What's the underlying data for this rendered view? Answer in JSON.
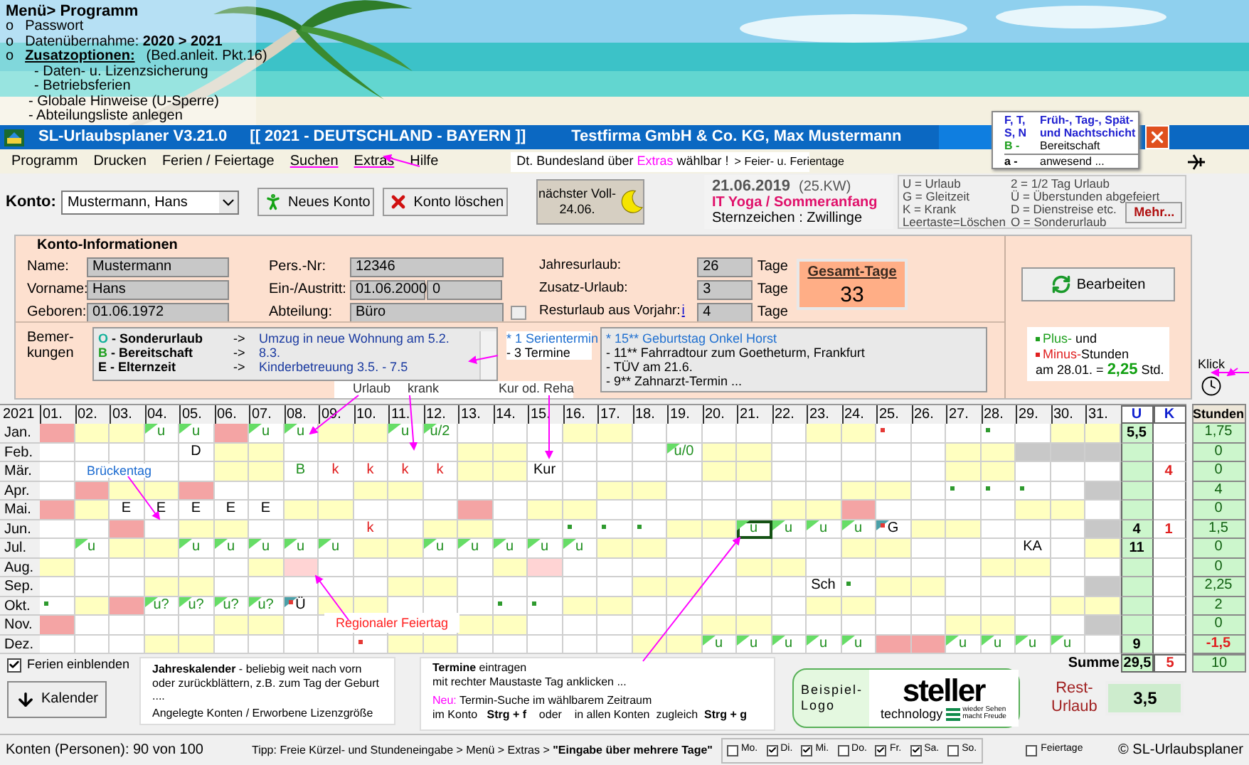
{
  "banner": {
    "menu_title": "Menü> Programm",
    "items": [
      {
        "bullet": "o",
        "text": "Passwort",
        "kind": "plain"
      },
      {
        "bullet": "o",
        "text": "Datenübernahme: **2020  >  2021**",
        "kind": "plain"
      },
      {
        "bullet": "o",
        "text": "**Zusatzoptionen:**",
        "note": "(Bed.anleit. Pkt.16)",
        "kind": "heading"
      }
    ],
    "subitems": [
      "- Daten-  u. Lizenzsicherung",
      "- Betriebsferien",
      "- Globale Hinweise (U-Sperre)",
      "- Abteilungsliste anlegen"
    ]
  },
  "title_bar": {
    "app": "SL-Urlaubsplaner  V3.21.0",
    "context": "[[ 2021 - DEUTSCHLAND - BAYERN ]]",
    "company": "Testfirma GmbH & Co. KG,  Max Mustermann"
  },
  "note_popup": [
    {
      "code": "F, T,",
      "desc": "Früh-, Tag-, Spät-",
      "kind": "shift"
    },
    {
      "code": "S, N",
      "desc": "und Nachtschicht",
      "kind": "shift"
    },
    {
      "code": "B -",
      "desc": "Bereitschaft",
      "kind": "standby"
    },
    {
      "code": "a -",
      "desc": "anwesend ...",
      "kind": "present"
    }
  ],
  "menu": [
    {
      "label": "Programm",
      "highlighted": false
    },
    {
      "label": "Drucken",
      "highlighted": false
    },
    {
      "label": "Ferien / Feiertage",
      "highlighted": false
    },
    {
      "label": "Suchen",
      "highlighted": true
    },
    {
      "label": "Extras",
      "highlighted": true
    },
    {
      "label": "Hilfe",
      "highlighted": false
    }
  ],
  "hint": {
    "before": "Dt. Bundesland  über",
    "highlight": "Extras",
    "after": "wählbar !",
    "link": "> Feier- u. Ferientage"
  },
  "toolbar": {
    "konto_label": "Konto:",
    "konto_value": "Mustermann, Hans",
    "buttons": [
      {
        "label": "Neues Konto",
        "kind": "new"
      },
      {
        "label": "Konto löschen",
        "kind": "delete"
      }
    ],
    "moon": [
      "nächster Voll-",
      "24.06."
    ]
  },
  "date_panel": {
    "date": "21.06.2019",
    "week": "(25.KW)",
    "event": "IT Yoga /  Sommeranfang",
    "zodiac": "Sternzeichen : Zwillinge"
  },
  "legend": {
    "left": [
      "U = Urlaub",
      "G = Gleitzeit",
      "K = Krank",
      "Leertaste=Löschen"
    ],
    "right": [
      "2 = 1/2 Tag Urlaub",
      "Ü = Überstunden abgefeiert",
      "D = Dienstreise etc.",
      "O = Sonderurlaub"
    ],
    "more": "Mehr..."
  },
  "account": {
    "title": "Konto-Informationen",
    "personal": [
      {
        "label": "Name:",
        "values": [
          "Mustermann"
        ]
      },
      {
        "label": "Vorname:",
        "values": [
          "Hans"
        ]
      },
      {
        "label": "Geboren:",
        "values": [
          "01.06.1972"
        ]
      }
    ],
    "work": [
      {
        "label": "Pers.-Nr:",
        "values": [
          "12346"
        ]
      },
      {
        "label": "Ein-/Austritt:",
        "values": [
          "01.06.2000",
          "0"
        ]
      },
      {
        "label": "Abteilung:",
        "values": [
          "Büro"
        ]
      }
    ],
    "vacation": [
      {
        "label": "Jahresurlaub:",
        "value": "26",
        "unit": "Tage"
      },
      {
        "label": "Zusatz-Urlaub:",
        "value": "3",
        "unit": "Tage"
      },
      {
        "label": "Resturlaub aus Vorjahr:",
        "info": "i",
        "value": "4",
        "unit": "Tage"
      }
    ],
    "total_label": "Gesamt-Tage",
    "total": "33",
    "edit": "Bearbeiten",
    "remarks_label": "Bemer-\nkungen",
    "remarks": [
      {
        "code": "O",
        "label": "- Sonderurlaub",
        "arrow": "->",
        "text": "Umzug in neue Wohnung am  5.2.",
        "kind": "special"
      },
      {
        "code": "B",
        "label": "- Bereitschaft",
        "arrow": "->",
        "text": "8.3.",
        "kind": "standby"
      },
      {
        "code": "E",
        "label": "- Elternzeit",
        "arrow": "->",
        "text": "Kinderbetreuung  3.5. - 7.5",
        "kind": "plain"
      }
    ],
    "series": [
      {
        "text": "* 1 Serientermin",
        "kind": "series"
      },
      {
        "text": "- 3 Termine",
        "kind": "plain"
      }
    ],
    "appointments": [
      {
        "text": "*   15**  Geburtstag Onkel Horst",
        "kind": "birthday"
      },
      {
        "text": "-   11**  Fahrradtour zum Goetheturm,  Frankfurt",
        "kind": "plain"
      },
      {
        "text": "-   TÜV am 21.6.",
        "kind": "plain"
      },
      {
        "text": "-   9**  Zahnarzt-Termin  ...",
        "kind": "plain"
      }
    ],
    "hours_note": {
      "plus": "Plus-",
      "plus_rest": "und",
      "minus": "Minus-",
      "minus_rest": "Stunden",
      "date": "am 28.01.  =",
      "value": "2,25",
      "unit": "Std."
    }
  },
  "annotations": {
    "vacation": "Urlaub",
    "sick": "krank",
    "cure": "Kur od. Reha",
    "bridge": "Brückentag",
    "regional": "Regionaler Feiertag",
    "click": "Klick"
  },
  "calendar": {
    "year": "2021",
    "days": [
      "01.",
      "02.",
      "03.",
      "04.",
      "05.",
      "06.",
      "07.",
      "08.",
      "09.",
      "10.",
      "11.",
      "12.",
      "13.",
      "14.",
      "15.",
      "16.",
      "17.",
      "18.",
      "19.",
      "20.",
      "21.",
      "22.",
      "23.",
      "24.",
      "25.",
      "26.",
      "27.",
      "28.",
      "29.",
      "30.",
      "31."
    ],
    "u_label": "U",
    "k_label": "K",
    "hours_label": "Stunden",
    "rows": [
      {
        "month": "Jan.",
        "u": "5,5",
        "hours": "1,75",
        "hours_negative": false,
        "cells": [
          {
            "kind": "holiday"
          },
          {
            "kind": "weekend"
          },
          {
            "kind": "weekend"
          },
          {
            "kind": "workday",
            "text": "u",
            "color": "#1f8f1f",
            "vacation_flag": true
          },
          {
            "kind": "workday",
            "text": "u",
            "color": "#1f8f1f",
            "vacation_flag": true
          },
          {
            "kind": "holiday"
          },
          {
            "kind": "workday",
            "text": "u",
            "color": "#1f8f1f",
            "vacation_flag": true
          },
          {
            "kind": "workday",
            "text": "u",
            "color": "#1f8f1f",
            "vacation_flag": true
          },
          {
            "kind": "weekend"
          },
          {
            "kind": "weekend"
          },
          {
            "kind": "workday",
            "text": "u",
            "color": "#1f8f1f",
            "vacation_flag": true
          },
          {
            "kind": "workday",
            "text": "u/2",
            "color": "#1f8f1f",
            "vacation_flag": true
          },
          {
            "kind": "workday"
          },
          {
            "kind": "workday"
          },
          {
            "kind": "workday"
          },
          {
            "kind": "weekend"
          },
          {
            "kind": "weekend"
          },
          {
            "kind": "workday"
          },
          {
            "kind": "workday"
          },
          {
            "kind": "workday"
          },
          {
            "kind": "workday"
          },
          {
            "kind": "workday"
          },
          {
            "kind": "weekend"
          },
          {
            "kind": "weekend"
          },
          {
            "kind": "workday",
            "alert": true
          },
          {
            "kind": "workday"
          },
          {
            "kind": "workday"
          },
          {
            "kind": "workday",
            "appointment": true
          },
          {
            "kind": "workday"
          },
          {
            "kind": "weekend"
          },
          {
            "kind": "weekend"
          }
        ]
      },
      {
        "month": "Feb.",
        "hours": "0",
        "hours_negative": false,
        "cells": [
          {
            "kind": "workday"
          },
          {
            "kind": "workday"
          },
          {
            "kind": "workday"
          },
          {
            "kind": "workday"
          },
          {
            "kind": "workday",
            "text": "D",
            "color": "#000000"
          },
          {
            "kind": "weekend"
          },
          {
            "kind": "weekend"
          },
          {
            "kind": "workday"
          },
          {
            "kind": "workday"
          },
          {
            "kind": "workday"
          },
          {
            "kind": "workday"
          },
          {
            "kind": "workday"
          },
          {
            "kind": "weekend"
          },
          {
            "kind": "weekend"
          },
          {
            "kind": "workday"
          },
          {
            "kind": "workday"
          },
          {
            "kind": "workday"
          },
          {
            "kind": "workday"
          },
          {
            "kind": "workday",
            "text": "u/0",
            "color": "#1f8f1f",
            "vacation_flag": true
          },
          {
            "kind": "weekend"
          },
          {
            "kind": "weekend"
          },
          {
            "kind": "workday"
          },
          {
            "kind": "workday"
          },
          {
            "kind": "workday"
          },
          {
            "kind": "workday"
          },
          {
            "kind": "workday"
          },
          {
            "kind": "weekend"
          },
          {
            "kind": "weekend"
          },
          {
            "kind": "none"
          },
          {
            "kind": "none"
          },
          {
            "kind": "none"
          }
        ]
      },
      {
        "month": "Mär.",
        "k": "4",
        "hours": "0",
        "hours_negative": false,
        "cells": [
          {
            "kind": "workday"
          },
          {
            "kind": "workday"
          },
          {
            "kind": "workday"
          },
          {
            "kind": "workday"
          },
          {
            "kind": "workday"
          },
          {
            "kind": "weekend"
          },
          {
            "kind": "weekend"
          },
          {
            "kind": "workday",
            "text": "B",
            "color": "#1f8f1f"
          },
          {
            "kind": "workday",
            "text": "k",
            "color": "#e02020"
          },
          {
            "kind": "workday",
            "text": "k",
            "color": "#e02020"
          },
          {
            "kind": "workday",
            "text": "k",
            "color": "#e02020"
          },
          {
            "kind": "workday",
            "text": "k",
            "color": "#e02020"
          },
          {
            "kind": "weekend"
          },
          {
            "kind": "weekend"
          },
          {
            "kind": "workday",
            "text": "Kur",
            "color": "#000000"
          },
          {
            "kind": "workday"
          },
          {
            "kind": "workday"
          },
          {
            "kind": "workday"
          },
          {
            "kind": "workday"
          },
          {
            "kind": "weekend"
          },
          {
            "kind": "weekend"
          },
          {
            "kind": "workday"
          },
          {
            "kind": "workday"
          },
          {
            "kind": "workday"
          },
          {
            "kind": "workday"
          },
          {
            "kind": "workday"
          },
          {
            "kind": "weekend"
          },
          {
            "kind": "weekend"
          },
          {
            "kind": "workday"
          },
          {
            "kind": "workday"
          },
          {
            "kind": "workday"
          }
        ]
      },
      {
        "month": "Apr.",
        "hours": "4",
        "hours_negative": false,
        "cells": [
          {
            "kind": "workday"
          },
          {
            "kind": "holiday"
          },
          {
            "kind": "weekend"
          },
          {
            "kind": "weekend"
          },
          {
            "kind": "holiday"
          },
          {
            "kind": "workday"
          },
          {
            "kind": "workday"
          },
          {
            "kind": "workday"
          },
          {
            "kind": "workday"
          },
          {
            "kind": "weekend"
          },
          {
            "kind": "weekend"
          },
          {
            "kind": "workday"
          },
          {
            "kind": "workday"
          },
          {
            "kind": "workday"
          },
          {
            "kind": "workday"
          },
          {
            "kind": "workday"
          },
          {
            "kind": "weekend"
          },
          {
            "kind": "weekend"
          },
          {
            "kind": "workday"
          },
          {
            "kind": "workday"
          },
          {
            "kind": "workday"
          },
          {
            "kind": "workday"
          },
          {
            "kind": "workday"
          },
          {
            "kind": "weekend"
          },
          {
            "kind": "weekend"
          },
          {
            "kind": "workday"
          },
          {
            "kind": "workday",
            "appointment": true
          },
          {
            "kind": "workday",
            "appointment": true
          },
          {
            "kind": "workday",
            "appointment": true
          },
          {
            "kind": "workday"
          },
          {
            "kind": "none"
          }
        ]
      },
      {
        "month": "Mai.",
        "hours": "0",
        "hours_negative": false,
        "cells": [
          {
            "kind": "holiday"
          },
          {
            "kind": "weekend"
          },
          {
            "kind": "workday",
            "text": "E",
            "color": "#000000"
          },
          {
            "kind": "workday",
            "text": "E",
            "color": "#000000"
          },
          {
            "kind": "workday",
            "text": "E",
            "color": "#000000"
          },
          {
            "kind": "workday",
            "text": "E",
            "color": "#000000"
          },
          {
            "kind": "workday",
            "text": "E",
            "color": "#000000"
          },
          {
            "kind": "weekend"
          },
          {
            "kind": "weekend"
          },
          {
            "kind": "workday"
          },
          {
            "kind": "workday"
          },
          {
            "kind": "workday"
          },
          {
            "kind": "holiday"
          },
          {
            "kind": "workday"
          },
          {
            "kind": "weekend"
          },
          {
            "kind": "weekend"
          },
          {
            "kind": "workday"
          },
          {
            "kind": "workday"
          },
          {
            "kind": "workday"
          },
          {
            "kind": "workday"
          },
          {
            "kind": "workday"
          },
          {
            "kind": "weekend"
          },
          {
            "kind": "weekend"
          },
          {
            "kind": "holiday"
          },
          {
            "kind": "workday"
          },
          {
            "kind": "workday"
          },
          {
            "kind": "workday"
          },
          {
            "kind": "workday"
          },
          {
            "kind": "weekend"
          },
          {
            "kind": "weekend"
          },
          {
            "kind": "workday"
          }
        ]
      },
      {
        "month": "Jun.",
        "u": "4",
        "k": "1",
        "hours": "1,5",
        "hours_negative": false,
        "cells": [
          {
            "kind": "workday"
          },
          {
            "kind": "workday"
          },
          {
            "kind": "holiday"
          },
          {
            "kind": "workday"
          },
          {
            "kind": "weekend"
          },
          {
            "kind": "weekend"
          },
          {
            "kind": "workday"
          },
          {
            "kind": "workday"
          },
          {
            "kind": "workday"
          },
          {
            "kind": "workday",
            "text": "k",
            "color": "#e02020"
          },
          {
            "kind": "workday"
          },
          {
            "kind": "weekend"
          },
          {
            "kind": "weekend"
          },
          {
            "kind": "workday"
          },
          {
            "kind": "workday"
          },
          {
            "kind": "workday",
            "appointment": true
          },
          {
            "kind": "workday",
            "appointment": true
          },
          {
            "kind": "workday",
            "appointment": true
          },
          {
            "kind": "weekend"
          },
          {
            "kind": "weekend"
          },
          {
            "kind": "workday",
            "text": "u",
            "color": "#1f8f1f",
            "vacation_flag": true,
            "outlined": true
          },
          {
            "kind": "workday",
            "text": "u",
            "color": "#1f8f1f",
            "vacation_flag": true
          },
          {
            "kind": "workday",
            "text": "u",
            "color": "#1f8f1f",
            "vacation_flag": true
          },
          {
            "kind": "workday",
            "text": "u",
            "color": "#1f8f1f",
            "vacation_flag": true
          },
          {
            "kind": "workday",
            "text": "G",
            "color": "#000000",
            "overtime_flag": true,
            "alert": true
          },
          {
            "kind": "weekend"
          },
          {
            "kind": "weekend"
          },
          {
            "kind": "workday"
          },
          {
            "kind": "workday"
          },
          {
            "kind": "workday"
          },
          {
            "kind": "none"
          }
        ]
      },
      {
        "month": "Jul.",
        "u": "11",
        "hours": "0",
        "hours_negative": false,
        "cells": [
          {
            "kind": "workday"
          },
          {
            "kind": "workday",
            "text": "u",
            "color": "#1f8f1f",
            "vacation_flag": true
          },
          {
            "kind": "weekend"
          },
          {
            "kind": "weekend"
          },
          {
            "kind": "workday",
            "text": "u",
            "color": "#1f8f1f",
            "vacation_flag": true
          },
          {
            "kind": "workday",
            "text": "u",
            "color": "#1f8f1f",
            "vacation_flag": true
          },
          {
            "kind": "workday",
            "text": "u",
            "color": "#1f8f1f",
            "vacation_flag": true
          },
          {
            "kind": "workday",
            "text": "u",
            "color": "#1f8f1f",
            "vacation_flag": true
          },
          {
            "kind": "workday",
            "text": "u",
            "color": "#1f8f1f",
            "vacation_flag": true
          },
          {
            "kind": "weekend"
          },
          {
            "kind": "weekend"
          },
          {
            "kind": "workday",
            "text": "u",
            "color": "#1f8f1f",
            "vacation_flag": true
          },
          {
            "kind": "workday",
            "text": "u",
            "color": "#1f8f1f",
            "vacation_flag": true
          },
          {
            "kind": "workday",
            "text": "u",
            "color": "#1f8f1f",
            "vacation_flag": true
          },
          {
            "kind": "workday",
            "text": "u",
            "color": "#1f8f1f",
            "vacation_flag": true
          },
          {
            "kind": "workday",
            "text": "u",
            "color": "#1f8f1f",
            "vacation_flag": true
          },
          {
            "kind": "weekend"
          },
          {
            "kind": "weekend"
          },
          {
            "kind": "workday"
          },
          {
            "kind": "workday"
          },
          {
            "kind": "workday"
          },
          {
            "kind": "workday"
          },
          {
            "kind": "workday"
          },
          {
            "kind": "weekend"
          },
          {
            "kind": "weekend"
          },
          {
            "kind": "workday"
          },
          {
            "kind": "workday"
          },
          {
            "kind": "workday"
          },
          {
            "kind": "workday",
            "text": "KA",
            "color": "#000000"
          },
          {
            "kind": "workday"
          },
          {
            "kind": "weekend"
          }
        ]
      },
      {
        "month": "Aug.",
        "hours": "0",
        "hours_negative": false,
        "cells": [
          {
            "kind": "weekend"
          },
          {
            "kind": "workday"
          },
          {
            "kind": "workday"
          },
          {
            "kind": "workday"
          },
          {
            "kind": "workday"
          },
          {
            "kind": "workday"
          },
          {
            "kind": "weekend"
          },
          {
            "kind": "regional"
          },
          {
            "kind": "workday"
          },
          {
            "kind": "workday"
          },
          {
            "kind": "workday"
          },
          {
            "kind": "workday"
          },
          {
            "kind": "workday"
          },
          {
            "kind": "weekend"
          },
          {
            "kind": "regional"
          },
          {
            "kind": "workday"
          },
          {
            "kind": "workday"
          },
          {
            "kind": "workday"
          },
          {
            "kind": "workday"
          },
          {
            "kind": "workday"
          },
          {
            "kind": "weekend"
          },
          {
            "kind": "weekend"
          },
          {
            "kind": "workday"
          },
          {
            "kind": "workday"
          },
          {
            "kind": "workday"
          },
          {
            "kind": "workday"
          },
          {
            "kind": "workday"
          },
          {
            "kind": "weekend"
          },
          {
            "kind": "weekend"
          },
          {
            "kind": "workday"
          },
          {
            "kind": "workday"
          }
        ]
      },
      {
        "month": "Sep.",
        "hours": "2,25",
        "hours_negative": false,
        "cells": [
          {
            "kind": "workday"
          },
          {
            "kind": "workday"
          },
          {
            "kind": "workday"
          },
          {
            "kind": "weekend"
          },
          {
            "kind": "weekend"
          },
          {
            "kind": "workday"
          },
          {
            "kind": "workday"
          },
          {
            "kind": "workday"
          },
          {
            "kind": "workday"
          },
          {
            "kind": "workday"
          },
          {
            "kind": "weekend"
          },
          {
            "kind": "weekend"
          },
          {
            "kind": "workday"
          },
          {
            "kind": "workday"
          },
          {
            "kind": "workday"
          },
          {
            "kind": "workday"
          },
          {
            "kind": "workday"
          },
          {
            "kind": "weekend"
          },
          {
            "kind": "weekend"
          },
          {
            "kind": "workday"
          },
          {
            "kind": "workday"
          },
          {
            "kind": "workday"
          },
          {
            "kind": "workday",
            "text": "Sch",
            "color": "#000000"
          },
          {
            "kind": "workday",
            "appointment": true
          },
          {
            "kind": "weekend"
          },
          {
            "kind": "weekend"
          },
          {
            "kind": "workday"
          },
          {
            "kind": "workday"
          },
          {
            "kind": "workday"
          },
          {
            "kind": "workday"
          },
          {
            "kind": "none"
          }
        ]
      },
      {
        "month": "Okt.",
        "hours": "2",
        "hours_negative": false,
        "cells": [
          {
            "kind": "workday",
            "appointment": true
          },
          {
            "kind": "weekend"
          },
          {
            "kind": "holiday"
          },
          {
            "kind": "workday",
            "text": "u?",
            "color": "#1f8f1f",
            "vacation_flag": true
          },
          {
            "kind": "workday",
            "text": "u?",
            "color": "#1f8f1f",
            "vacation_flag": true
          },
          {
            "kind": "workday",
            "text": "u?",
            "color": "#1f8f1f",
            "vacation_flag": true
          },
          {
            "kind": "workday",
            "text": "u?",
            "color": "#1f8f1f",
            "vacation_flag": true
          },
          {
            "kind": "workday",
            "text": "Ü",
            "color": "#000000",
            "overtime_flag": true,
            "alert": true
          },
          {
            "kind": "weekend"
          },
          {
            "kind": "weekend"
          },
          {
            "kind": "workday"
          },
          {
            "kind": "workday"
          },
          {
            "kind": "workday"
          },
          {
            "kind": "workday",
            "appointment": true
          },
          {
            "kind": "workday",
            "appointment": true
          },
          {
            "kind": "weekend"
          },
          {
            "kind": "weekend"
          },
          {
            "kind": "workday"
          },
          {
            "kind": "workday"
          },
          {
            "kind": "workday"
          },
          {
            "kind": "workday"
          },
          {
            "kind": "workday"
          },
          {
            "kind": "weekend"
          },
          {
            "kind": "weekend"
          },
          {
            "kind": "workday"
          },
          {
            "kind": "workday"
          },
          {
            "kind": "workday"
          },
          {
            "kind": "workday"
          },
          {
            "kind": "workday"
          },
          {
            "kind": "weekend"
          },
          {
            "kind": "weekend"
          }
        ]
      },
      {
        "month": "Nov.",
        "hours": "0",
        "hours_negative": false,
        "cells": [
          {
            "kind": "holiday"
          },
          {
            "kind": "workday"
          },
          {
            "kind": "workday"
          },
          {
            "kind": "workday"
          },
          {
            "kind": "workday"
          },
          {
            "kind": "weekend"
          },
          {
            "kind": "weekend"
          },
          {
            "kind": "workday"
          },
          {
            "kind": "workday"
          },
          {
            "kind": "workday"
          },
          {
            "kind": "workday"
          },
          {
            "kind": "workday"
          },
          {
            "kind": "weekend"
          },
          {
            "kind": "weekend"
          },
          {
            "kind": "workday"
          },
          {
            "kind": "workday"
          },
          {
            "kind": "workday"
          },
          {
            "kind": "workday"
          },
          {
            "kind": "workday"
          },
          {
            "kind": "weekend"
          },
          {
            "kind": "weekend"
          },
          {
            "kind": "workday"
          },
          {
            "kind": "workday"
          },
          {
            "kind": "workday"
          },
          {
            "kind": "workday"
          },
          {
            "kind": "workday"
          },
          {
            "kind": "weekend"
          },
          {
            "kind": "weekend"
          },
          {
            "kind": "workday"
          },
          {
            "kind": "workday"
          },
          {
            "kind": "none"
          }
        ]
      },
      {
        "month": "Dez.",
        "u": "9",
        "hours": "-1,5",
        "hours_negative": true,
        "cells": [
          {
            "kind": "workday"
          },
          {
            "kind": "workday"
          },
          {
            "kind": "workday"
          },
          {
            "kind": "weekend"
          },
          {
            "kind": "weekend"
          },
          {
            "kind": "workday"
          },
          {
            "kind": "workday"
          },
          {
            "kind": "workday"
          },
          {
            "kind": "workday"
          },
          {
            "kind": "workday",
            "alert": true
          },
          {
            "kind": "weekend"
          },
          {
            "kind": "weekend"
          },
          {
            "kind": "workday"
          },
          {
            "kind": "workday"
          },
          {
            "kind": "workday"
          },
          {
            "kind": "workday"
          },
          {
            "kind": "workday"
          },
          {
            "kind": "weekend"
          },
          {
            "kind": "weekend"
          },
          {
            "kind": "workday",
            "text": "u",
            "color": "#1f8f1f",
            "vacation_flag": true
          },
          {
            "kind": "workday",
            "text": "u",
            "color": "#1f8f1f",
            "vacation_flag": true
          },
          {
            "kind": "workday",
            "text": "u",
            "color": "#1f8f1f",
            "vacation_flag": true
          },
          {
            "kind": "workday",
            "text": "u",
            "color": "#1f8f1f",
            "vacation_flag": true
          },
          {
            "kind": "workday",
            "text": "u",
            "color": "#1f8f1f",
            "vacation_flag": true
          },
          {
            "kind": "holiday"
          },
          {
            "kind": "holiday"
          },
          {
            "kind": "workday",
            "text": "u",
            "color": "#1f8f1f",
            "vacation_flag": true
          },
          {
            "kind": "workday",
            "text": "u",
            "color": "#1f8f1f",
            "vacation_flag": true
          },
          {
            "kind": "workday",
            "text": "u",
            "color": "#1f8f1f",
            "vacation_flag": true
          },
          {
            "kind": "workday",
            "text": "u",
            "color": "#1f8f1f",
            "vacation_flag": true
          },
          {
            "kind": "workday"
          }
        ]
      }
    ],
    "sum_label": "Summe",
    "sum_u": "29,5",
    "sum_k": "5",
    "sum_hours": "10"
  },
  "bottom": {
    "holidays_checkbox": {
      "label": "Ferien einblenden",
      "checked": true
    },
    "calendar_button": "Kalender",
    "year_note": [
      "**Jahreskalender**  - beliebig weit nach vorn  oder zurückblättern,  z.B. zum Tag der Geburt ....",
      "Angelegte Konten  / Erworbene  Lizenzgröße"
    ],
    "dates_note": {
      "lines": [
        "**Termine** eintragen",
        "mit rechter Maustaste  Tag anklicken  ..."
      ],
      "new_label": "Neu:",
      "new_text": "Termin-Suche  im wählbarem  Zeitraum",
      "search": "im Konto   **Strg + f**    oder    in allen Konten  zugleich  **Strg + g**"
    },
    "logo": {
      "sample": [
        "Beispiel-",
        "Logo"
      ],
      "brand": "steller",
      "sub": "technology",
      "slogan": [
        "wieder Sehen",
        "macht Freude"
      ]
    },
    "rest_label": "Rest-\nUrlaub",
    "rest_value": "3,5"
  },
  "status_bar": {
    "accounts": "Konten (Personen):  90 von 100",
    "tip": "Tipp:   Freie Kürzel- und Stundeneingabe > Menü > Extras > **\"Eingabe über mehrere Tage\"**",
    "weekdays": [
      {
        "label": "Mo.",
        "checked": false
      },
      {
        "label": "Di.",
        "checked": true
      },
      {
        "label": "Mi.",
        "checked": true
      },
      {
        "label": "Do.",
        "checked": false
      },
      {
        "label": "Fr.",
        "checked": true
      },
      {
        "label": "Sa.",
        "checked": true
      },
      {
        "label": "So.",
        "checked": false
      }
    ],
    "holidays": {
      "label": "Feiertage",
      "checked": false
    },
    "copyright": "© SL-Urlaubsplaner"
  }
}
